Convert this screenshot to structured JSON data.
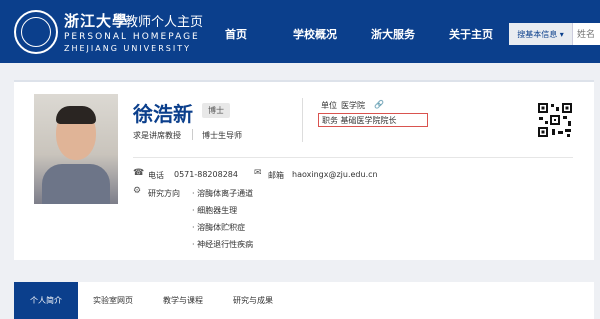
{
  "header": {
    "logo_cn": "浙江大學",
    "logo_sub": "教师个人主页",
    "logo_en1": "PERSONAL HOMEPAGE",
    "logo_en2": "ZHEJIANG UNIVERSITY",
    "nav": [
      "首页",
      "学校概况",
      "浙大服务",
      "关于主页"
    ],
    "search_select": "搜基本信息 ▾",
    "search_placeholder": "姓名"
  },
  "profile": {
    "name": "徐浩新",
    "degree": "博士",
    "title1": "求是讲席教授",
    "title2": "博士生导师",
    "unit_label": "单位",
    "unit_value": "医学院",
    "position_label": "职务",
    "position_value": "基础医学院院长",
    "phone_label": "电话",
    "phone_value": "0571-88208284",
    "email_label": "邮箱",
    "email_value": "haoxingx@zju.edu.cn",
    "research_label": "研究方向",
    "research": [
      "· 溶酶体离子通道",
      "· 细胞器生理",
      "· 溶酶体贮积症",
      "· 神经退行性疾病"
    ]
  },
  "tabs": [
    "个人简介",
    "实验室网页",
    "教学与课程",
    "研究与成果"
  ],
  "colors": {
    "brand": "#0b3f8c",
    "highlight_border": "#d9534f"
  }
}
